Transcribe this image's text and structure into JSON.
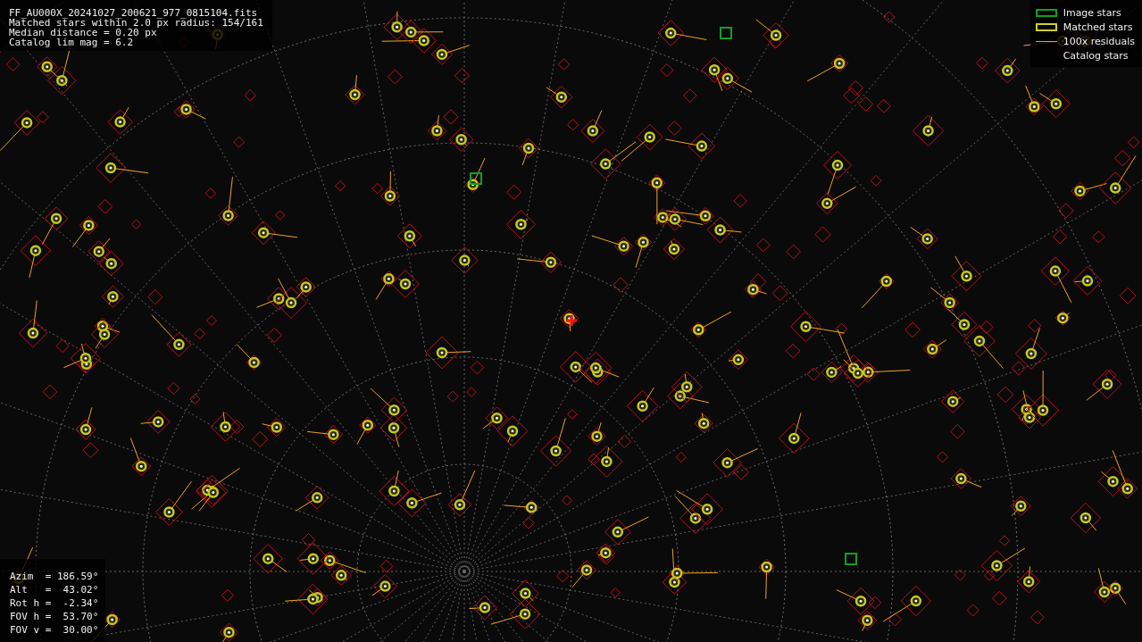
{
  "file_info": {
    "lines": [
      "FF_AU000X_20241027_200621_977_0815104.fits",
      "Matched stars within 2.0 px radius: 154/161",
      "Median distance = 0.20 px",
      "Catalog lim mag = 6.2"
    ]
  },
  "legend": [
    {
      "kind": "image",
      "label": "Image stars"
    },
    {
      "kind": "matched",
      "label": "Matched stars"
    },
    {
      "kind": "residual",
      "label": "100x residuals"
    },
    {
      "kind": "catalog",
      "label": "Catalog stars"
    }
  ],
  "pointing": {
    "lines": [
      "Azim  = 186.59°",
      "Alt   =  43.02°",
      "Rot h =  -2.34°",
      "FOV h =  53.70°",
      "FOV v =  30.00°"
    ]
  }
}
